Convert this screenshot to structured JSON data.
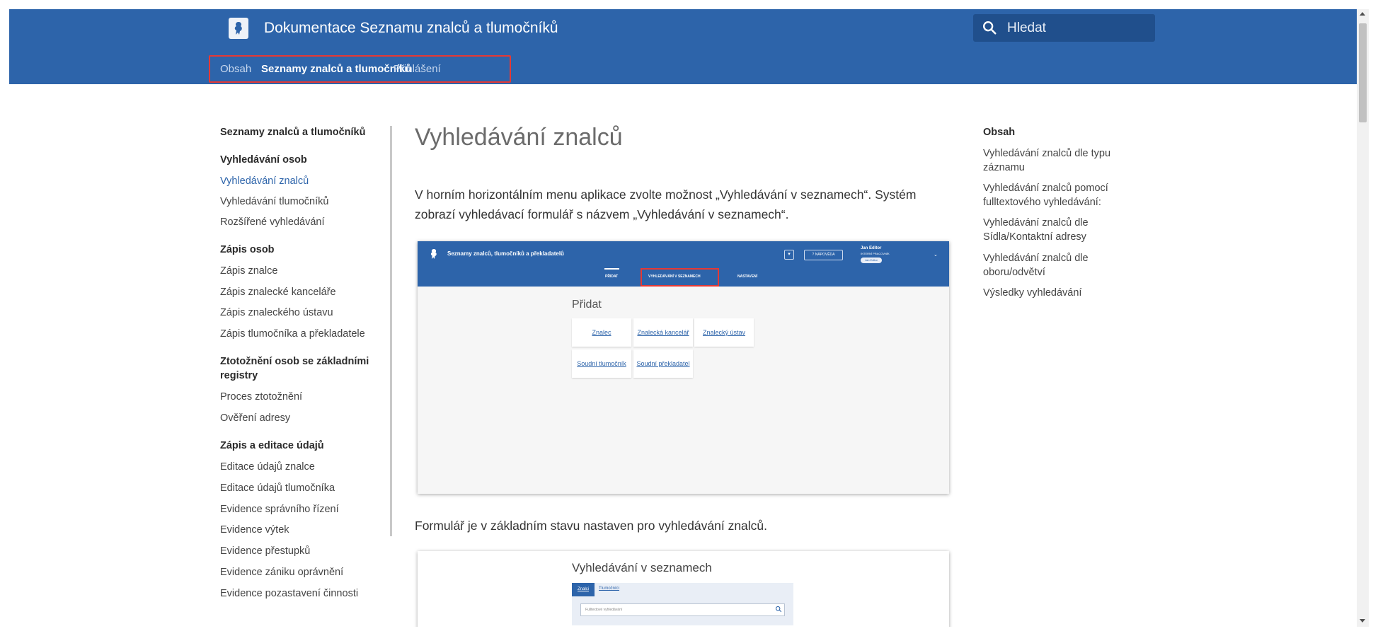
{
  "header": {
    "site_title": "Dokumentace Seznamu znalců a tlumočníků",
    "search_placeholder": "Hledat",
    "tabs": [
      {
        "label": "Obsah"
      },
      {
        "label": "Seznamy znalců a tlumočníků"
      },
      {
        "label": "Přihlášení"
      }
    ],
    "colors": {
      "bar": "#2d64aa",
      "highlight": "#e53935"
    }
  },
  "leftnav": {
    "title": "Seznamy znalců a tlumočníků",
    "sections": [
      {
        "heading": "Vyhledávání osob",
        "items": [
          "Vyhledávání znalců",
          "Vyhledávání tlumočníků",
          "Rozšířené vyhledávání"
        ]
      },
      {
        "heading": "Zápis osob",
        "items": [
          "Zápis znalce",
          "Zápis znalecké kanceláře",
          "Zápis znaleckého ústavu",
          "Zápis tlumočníka a překladatele"
        ]
      },
      {
        "heading": "Ztotožnění osob se základními registry",
        "items": [
          "Proces ztotožnění",
          "Ověření adresy"
        ]
      },
      {
        "heading": "Zápis a editace údajů",
        "items": [
          "Editace údajů znalce",
          "Editace údajů tlumočníka",
          "Evidence správního řízení",
          "Evidence výtek",
          "Evidence přestupků",
          "Evidence zániku oprávnění",
          "Evidence pozastavení činnosti"
        ]
      }
    ]
  },
  "main": {
    "heading": "Vyhledávání znalců",
    "paragraph1": "V horním horizontálním menu aplikace zvolte možnost „Vyhledávání v seznamech“. Systém zobrazí vyhledávací formulář s názvem „Vyhledávání v seznamech“.",
    "paragraph2": "Formulář je v základním stavu nastaven pro vyhledávání znalců.",
    "screenshot1": {
      "app_title": "Seznamy znalců, tlumočníků a překladatelů",
      "help_label": "NÁPOVĚDA",
      "user_name": "Jan Editor",
      "user_role": "INTERNÍ PRACOVNÍK",
      "user_pill": "Jan Editor",
      "nav": [
        "PŘIDAT",
        "VYHLEDÁVÁNÍ V SEZNAMECH",
        "NASTAVENÍ"
      ],
      "section_title": "Přidat",
      "tiles": [
        "Znalec",
        "Znalecká kancelář",
        "Znalecký ústav",
        "Soudní tlumočník",
        "Soudní překladatel"
      ]
    },
    "screenshot2": {
      "title": "Vyhledávání v seznamech",
      "tabs": [
        "Znalci",
        "Tlumočníci"
      ],
      "input_placeholder": "Fulltextové vyhledávání"
    }
  },
  "toc": {
    "title": "Obsah",
    "items": [
      "Vyhledávání znalců dle typu záznamu",
      "Vyhledávání znalců pomocí fulltextového vyhledávání:",
      "Vyhledávání znalců dle Sídla/Kontaktní adresy",
      "Vyhledávání znalců dle oboru/odvětví",
      "Výsledky vyhledávání"
    ]
  }
}
